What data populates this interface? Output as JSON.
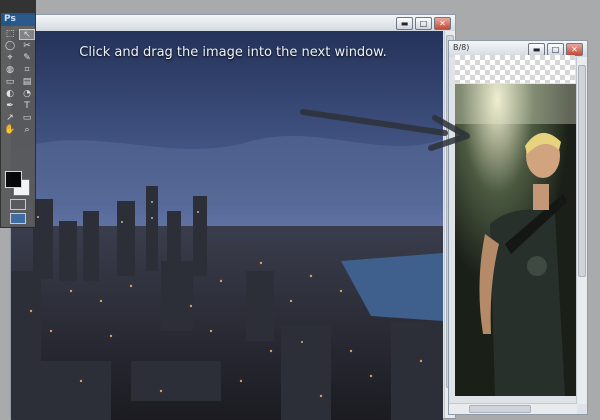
{
  "instruction": "Click and drag the image into the next window.",
  "main_window": {
    "controls": {
      "minimize": "▬",
      "maximize": "□",
      "close": "✕"
    }
  },
  "second_window": {
    "title_fragment": "B/8)",
    "controls": {
      "minimize": "▬",
      "maximize": "□",
      "close": "✕"
    }
  },
  "toolbar": {
    "app_label": "Ps",
    "tools": [
      "⬚",
      "↖",
      "◯",
      "✂",
      "⌖",
      "✎",
      "◍",
      "⌗",
      "▭",
      "▤",
      "◐",
      "◔",
      "✒",
      "T",
      "↗",
      "▭",
      "✋",
      "⌕"
    ],
    "foreground_color": "#000000",
    "background_color": "#ffffff"
  },
  "icons": {
    "arrow": "drag-direction-arrow-icon"
  }
}
